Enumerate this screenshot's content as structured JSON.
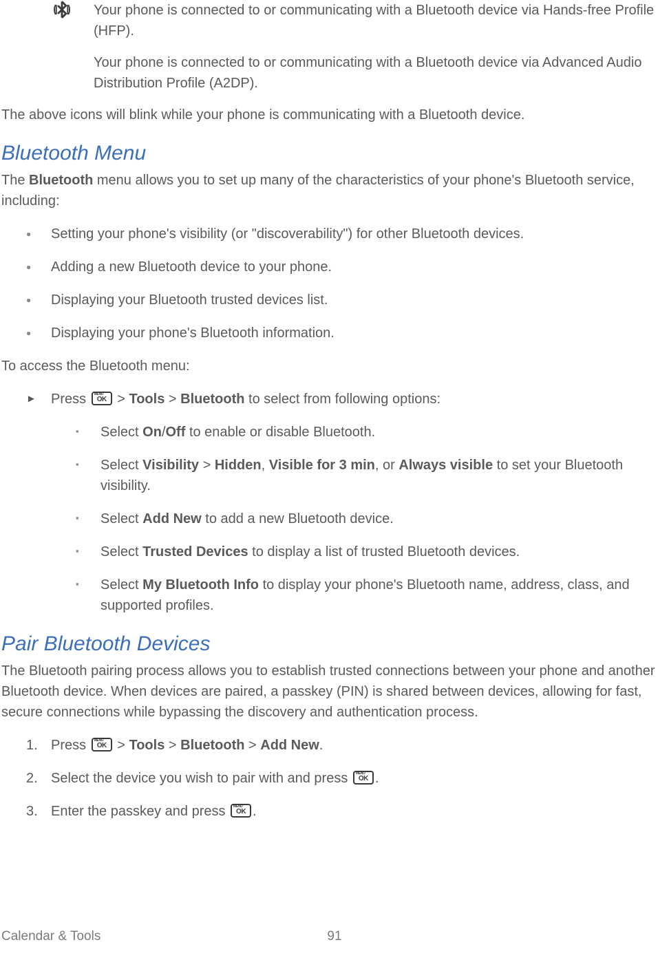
{
  "iconRow1": {
    "desc": "Your phone is connected to or communicating with a Bluetooth device via Hands-free Profile (HFP)."
  },
  "iconRow2": {
    "desc": "Your phone is connected to or communicating with a Bluetooth device via Advanced Audio Distribution Profile (A2DP)."
  },
  "blinkNote": "The above icons will blink while your phone is communicating with a Bluetooth device.",
  "section1": {
    "heading": "Bluetooth Menu",
    "intro_pre": "The ",
    "intro_bold": "Bluetooth",
    "intro_post": " menu allows you to set up many of the characteristics of your phone's Bluetooth service, including:",
    "bullets": [
      "Setting your phone's visibility (or \"discoverability\") for other Bluetooth devices.",
      "Adding a new Bluetooth device to your phone.",
      "Displaying your Bluetooth trusted devices list.",
      "Displaying your phone's Bluetooth information."
    ],
    "access_intro": "To access the Bluetooth menu:",
    "press_pre": "Press ",
    "press_sep": " > ",
    "press_b1": "Tools",
    "press_b2": "Bluetooth",
    "press_post": " to select from following options:",
    "sub": {
      "s1_pre": "Select ",
      "s1_b1": "On",
      "s1_slash": "/",
      "s1_b2": "Off",
      "s1_post": " to enable or disable Bluetooth.",
      "s2_pre": "Select ",
      "s2_b1": "Visibility",
      "s2_sep1": " > ",
      "s2_b2": "Hidden",
      "s2_comma": ", ",
      "s2_b3": "Visible for 3 min",
      "s2_or": ", or ",
      "s2_b4": "Always visible",
      "s2_post": " to set your Bluetooth visibility.",
      "s3_pre": "Select ",
      "s3_b1": "Add New",
      "s3_post": " to add a new Bluetooth device.",
      "s4_pre": "Select ",
      "s4_b1": "Trusted Devices",
      "s4_post": " to display a list of trusted Bluetooth devices.",
      "s5_pre": "Select ",
      "s5_b1": "My Bluetooth Info",
      "s5_post": " to display your phone's Bluetooth name, address, class, and supported profiles."
    }
  },
  "section2": {
    "heading": "Pair Bluetooth Devices",
    "intro": "The Bluetooth pairing process allows you to establish trusted connections between your phone and another Bluetooth device. When devices are paired, a passkey (PIN) is shared between devices, allowing for fast, secure connections while bypassing the discovery and authentication process.",
    "step1_pre": "Press ",
    "step1_sep": " > ",
    "step1_b1": "Tools",
    "step1_b2": "Bluetooth",
    "step1_b3": "Add New",
    "step1_post": ".",
    "step2_pre": "Select the device you wish to pair with and press ",
    "step2_post": ".",
    "step3_pre": "Enter the passkey and press ",
    "step3_post": "."
  },
  "footer": {
    "section": "Calendar & Tools",
    "page": "91"
  }
}
